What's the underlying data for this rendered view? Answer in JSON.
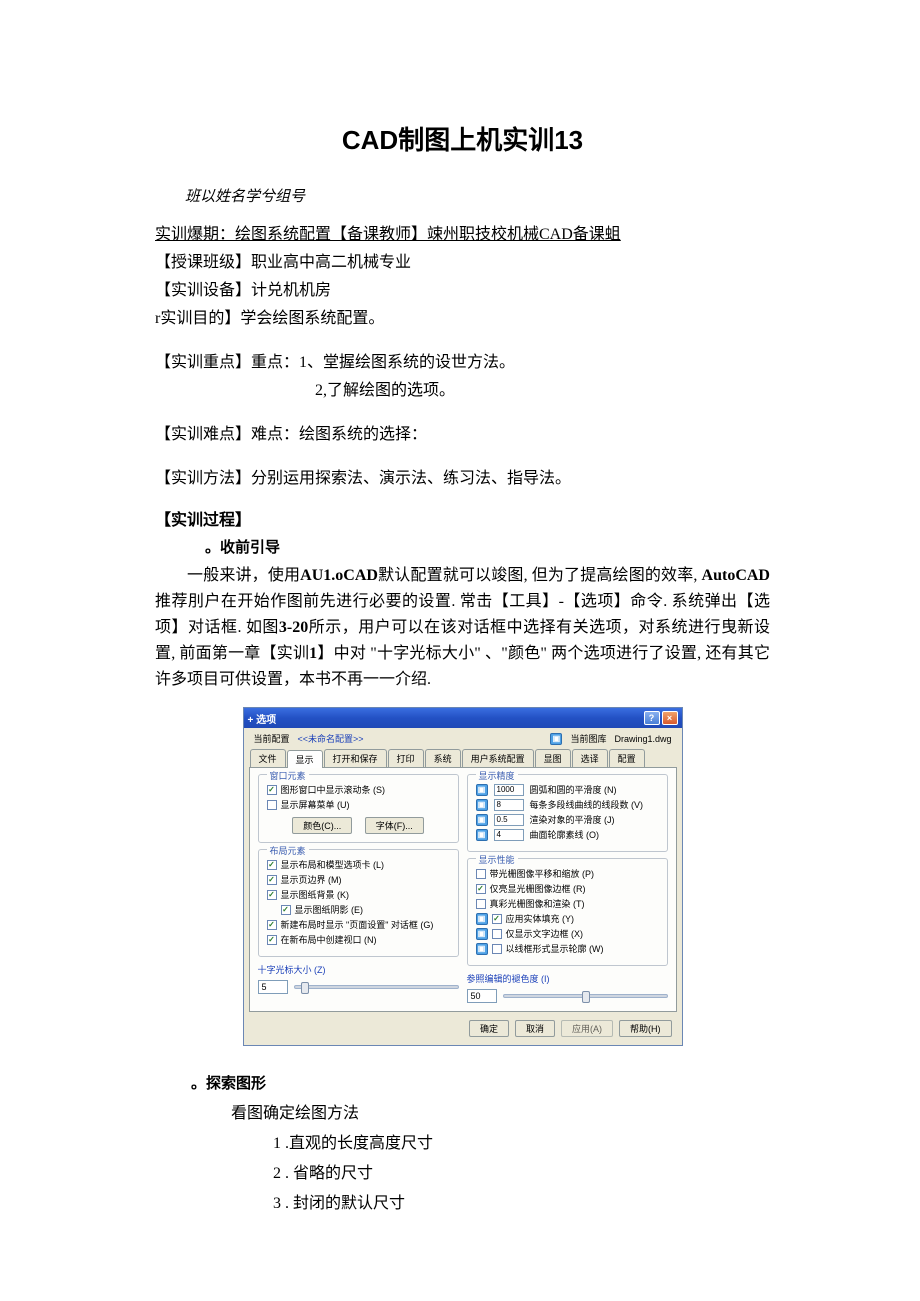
{
  "title": "CAD制图上机实训13",
  "header_line": "班以姓名学兮组号",
  "line_subject": "实训爆期：绘图系统配置【备课教师】竦州职技校机械CAD备课蛆",
  "line_class": "【授课班级】职业高中高二机械专业",
  "line_equip": "【实训设备】计兑机机房",
  "line_goal": "r实训目的】学会绘图系统配置。",
  "line_key_label": "【实训重点】重点：1、堂握绘图系统的设世方法。",
  "line_key_2": "2,了解绘图的选项。",
  "line_diff": "【实训难点】难点：绘图系统的选择：",
  "line_method": "【实训方法】分别运用探索法、演示法、练习法、指导法。",
  "process_label": "【实训过程】",
  "sub_pre": "。收前引导",
  "para_text_1a": "一般来讲，使用",
  "para_bold_1": "AU1.oCAD",
  "para_text_1b": "默认配置就可以竣图, 但为了提高绘图的效率, ",
  "para_bold_2": "AutoCAD",
  "para_text_1c": "推荐刖户在开始作图前先进行必要的设置. 常击【工具】-【选项】命令. 系统弹出【选项】对话框. 如图",
  "para_bold_3": "3-20",
  "para_text_1d": "所示，用户可以在该对话框中选择有关选项，对系统进行曳新设置, 前面第一章【实训",
  "para_bold_4": "1",
  "para_text_1e": "】中对 \"十字光标大小\" 、\"颜色\" 两个选项进行了设置, 还有其它许多项目可供设置，本书不再一一介绍.",
  "dialog": {
    "title": "+ 选项",
    "cfg_label": "当前配置",
    "cfg_value": "<<未命名配置>>",
    "draw_label": "当前图库",
    "draw_value": "Drawing1.dwg",
    "tabs": [
      "文件",
      "显示",
      "打开和保存",
      "打印",
      "系统",
      "用户系统配置",
      "显图",
      "选译",
      "配置"
    ],
    "group1": {
      "title": "窗口元素",
      "chk1": "图形窗口中显示滚动条 (S)",
      "chk2": "显示屏幕菜单 (U)",
      "btn_color": "颜色(C)...",
      "btn_font": "字体(F)..."
    },
    "group2": {
      "title": "显示精度",
      "r1": {
        "val": "1000",
        "label": "圆弧和圆的平滑度 (N)"
      },
      "r2": {
        "val": "8",
        "label": "每条多段线曲线的线段数 (V)"
      },
      "r3": {
        "val": "0.5",
        "label": "渲染对象的平滑度 (J)"
      },
      "r4": {
        "val": "4",
        "label": "曲面轮廓素线 (O)"
      }
    },
    "group3": {
      "title": "布局元素",
      "c1": "显示布局和模型选项卡 (L)",
      "c2": "显示页边界 (M)",
      "c3": "显示图纸背景 (K)",
      "c4": "显示图纸阴影 (E)",
      "c5": "新建布局时显示 \"页面设置\" 对话框 (G)",
      "c6": "在新布局中创建视口 (N)"
    },
    "group4": {
      "title": "显示性能",
      "c1": "带光栅图像平移和缩放 (P)",
      "c2": "仅亮显光栅图像边框 (R)",
      "c3": "真彩光栅图像和渲染 (T)",
      "c4": "应用实体填充 (Y)",
      "c5": "仅显示文字边框 (X)",
      "c6": "以线框形式显示轮廓 (W)"
    },
    "slider_left": {
      "title": "十字光标大小 (Z)",
      "val": "5"
    },
    "slider_right": {
      "title": "参照编辑的褪色度 (I)",
      "val": "50"
    },
    "btns": {
      "ok": "确定",
      "cancel": "取消",
      "apply": "应用(A)",
      "help": "帮助(H)"
    }
  },
  "explore_heading": "。探索图形",
  "explore_line": "看图确定绘图方法",
  "explore_items": [
    "1 .直观的长度高度尺寸",
    "2 . 省略的尺寸",
    "3 . 封闭的默认尺寸"
  ]
}
